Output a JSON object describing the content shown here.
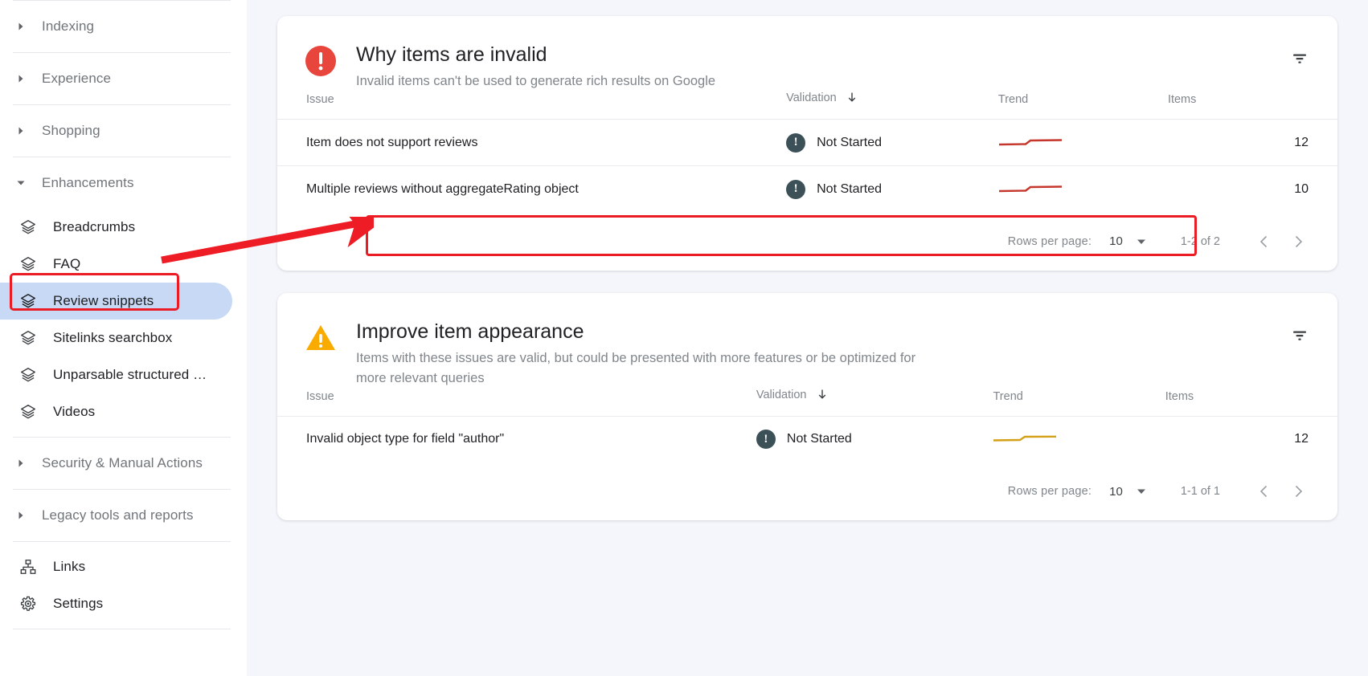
{
  "sidebar": {
    "groups_top": [
      {
        "label": "Indexing",
        "expanded": false,
        "icon": "chevron-right-icon"
      },
      {
        "label": "Experience",
        "expanded": false,
        "icon": "chevron-right-icon"
      },
      {
        "label": "Shopping",
        "expanded": false,
        "icon": "chevron-right-icon"
      },
      {
        "label": "Enhancements",
        "expanded": true,
        "icon": "chevron-down-icon"
      }
    ],
    "enhancement_items": [
      {
        "label": "Breadcrumbs",
        "icon": "layers-icon",
        "selected": false
      },
      {
        "label": "FAQ",
        "icon": "layers-icon",
        "selected": false
      },
      {
        "label": "Review snippets",
        "icon": "layers-icon",
        "selected": true
      },
      {
        "label": "Sitelinks searchbox",
        "icon": "layers-icon",
        "selected": false
      },
      {
        "label": "Unparsable structured …",
        "icon": "layers-icon",
        "selected": false
      },
      {
        "label": "Videos",
        "icon": "layers-icon",
        "selected": false
      }
    ],
    "groups_bottom": [
      {
        "label": "Security & Manual Actions",
        "expanded": false,
        "icon": "chevron-right-icon"
      },
      {
        "label": "Legacy tools and reports",
        "expanded": false,
        "icon": "chevron-right-icon"
      }
    ],
    "links_item": {
      "label": "Links",
      "icon": "sitemap-icon"
    },
    "settings_item": {
      "label": "Settings",
      "icon": "gear-icon"
    }
  },
  "cards": [
    {
      "title": "Why items are invalid",
      "subtitle": "Invalid items can't be used to generate rich results on Google",
      "status_icon": "error-circle-icon",
      "status_color": "#e8453c",
      "filter_icon": "filter-list-icon",
      "columns": {
        "issue": "Issue",
        "validation": "Validation",
        "trend": "Trend",
        "items": "Items"
      },
      "sort_indicator": "arrow-down-icon",
      "rows": [
        {
          "issue": "Item does not support reviews",
          "validation": "Not Started",
          "items": "12",
          "trend_color": "#c5372c",
          "highlighted": false
        },
        {
          "issue": "Multiple reviews without aggregateRating object",
          "validation": "Not Started",
          "items": "10",
          "trend_color": "#c5372c",
          "highlighted": true
        }
      ],
      "pagination": {
        "rows_per_page_label": "Rows per page:",
        "rows_per_page_value": "10",
        "range": "1-2 of 2",
        "prev_icon": "chevron-left-icon",
        "next_icon": "chevron-right-icon"
      }
    },
    {
      "title": "Improve item appearance",
      "subtitle": "Items with these issues are valid, but could be presented with more features or be optimized for more relevant queries",
      "status_icon": "warning-triangle-icon",
      "status_color": "#f9ab00",
      "filter_icon": "filter-list-icon",
      "columns": {
        "issue": "Issue",
        "validation": "Validation",
        "trend": "Trend",
        "items": "Items"
      },
      "sort_indicator": "arrow-down-icon",
      "rows": [
        {
          "issue": "Invalid object type for field \"author\"",
          "validation": "Not Started",
          "items": "12",
          "trend_color": "#d4a017",
          "highlighted": false
        }
      ],
      "pagination": {
        "rows_per_page_label": "Rows per page:",
        "rows_per_page_value": "10",
        "range": "1-1 of 1",
        "prev_icon": "chevron-left-icon",
        "next_icon": "chevron-right-icon"
      }
    }
  ],
  "annotations": {
    "highlight_color": "#ec1c24",
    "arrow_icon": "arrow-pointer-icon",
    "boxes": [
      {
        "target": "sidebar-item-review-snippets"
      },
      {
        "target": "table-row-multiple-reviews"
      }
    ]
  },
  "colors": {
    "selected_nav_bg": "#c7d9f5",
    "page_bg": "#f4f6fb",
    "card_bg": "#ffffff",
    "text_primary": "#202124",
    "text_secondary": "#80868b",
    "status_chip": "#3c5157"
  }
}
